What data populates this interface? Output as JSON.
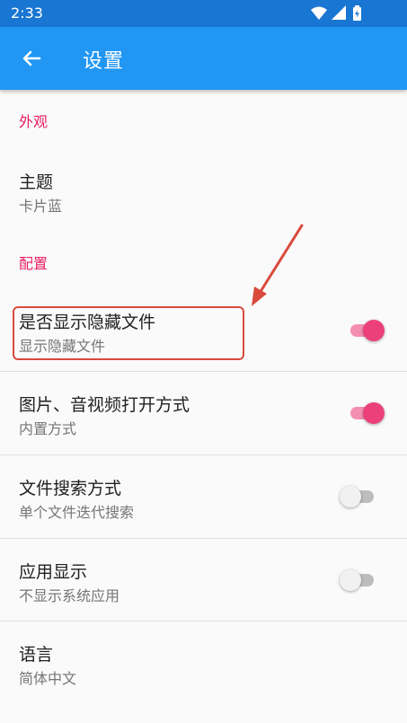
{
  "status_bar": {
    "time": "2:33",
    "icons": [
      "wifi-icon",
      "signal-icon",
      "battery-charging-icon"
    ]
  },
  "app_bar": {
    "back_icon": "back-arrow-icon",
    "title": "设置"
  },
  "sections": [
    {
      "header": "外观",
      "items": [
        {
          "title": "主题",
          "subtitle": "卡片蓝"
        }
      ]
    },
    {
      "header": "配置",
      "items": [
        {
          "title": "是否显示隐藏文件",
          "subtitle": "显示隐藏文件",
          "switch_on": true
        },
        {
          "title": "图片、音视频打开方式",
          "subtitle": "内置方式",
          "switch_on": true
        },
        {
          "title": "文件搜索方式",
          "subtitle": "单个文件迭代搜索",
          "switch_on": false
        },
        {
          "title": "应用显示",
          "subtitle": "不显示系统应用",
          "switch_on": false
        },
        {
          "title": "语言",
          "subtitle": "简体中文"
        }
      ]
    }
  ],
  "colors": {
    "status_bar": "#1976d2",
    "app_bar": "#2196f3",
    "section_header": "#e91e63",
    "switch_on_thumb": "#ec407a",
    "switch_on_track": "#f48fb1",
    "annotation": "#d94a3c"
  },
  "watermark": "出色软件站"
}
